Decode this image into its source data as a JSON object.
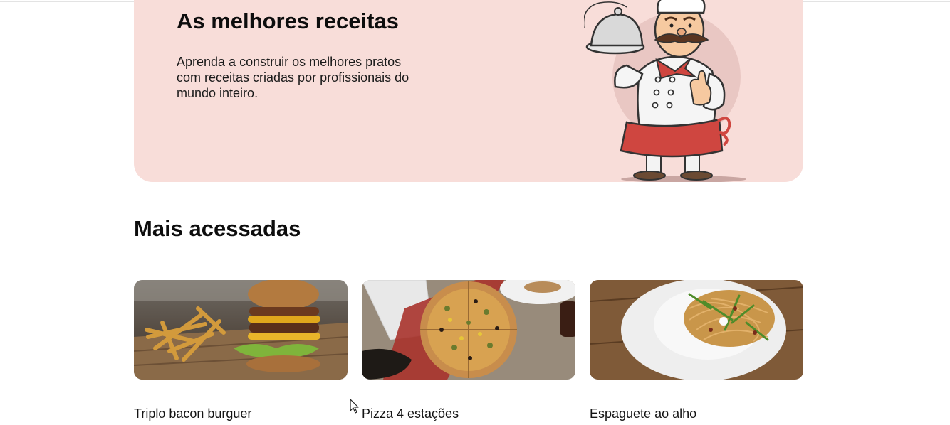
{
  "hero": {
    "title": "As melhores receitas",
    "description": "Aprenda a construir os melhores pratos com receitas criadas por profissionais do mundo inteiro.",
    "illustration_icon": "chef-illustration",
    "background_color": "#f8ddd9"
  },
  "most_accessed": {
    "title": "Mais acessadas",
    "recipes": [
      {
        "title": "Triplo bacon burguer",
        "image_icon": "burger-fries-photo"
      },
      {
        "title": "Pizza 4 estações",
        "image_icon": "pizza-photo"
      },
      {
        "title": "Espaguete ao alho",
        "image_icon": "spaghetti-photo"
      }
    ]
  }
}
